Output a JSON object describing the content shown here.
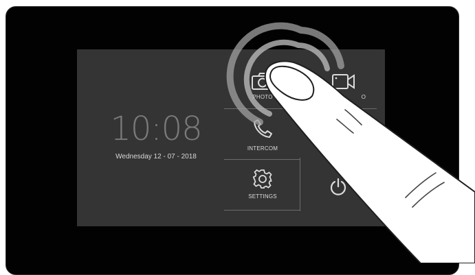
{
  "clock": {
    "time": "10:08",
    "date": "Wednesday 12 - 07 - 2018"
  },
  "menu": {
    "photo": {
      "label": "PHOTO",
      "icon": "camera-icon"
    },
    "video": {
      "label": "VIDEO",
      "visible_label": "O",
      "icon": "video-camera-icon"
    },
    "intercom": {
      "label": "INTERCOM",
      "icon": "phone-icon"
    },
    "settings": {
      "label": "SETTINGS",
      "icon": "gear-icon"
    },
    "power": {
      "icon": "power-icon"
    }
  },
  "colors": {
    "device": "#020202",
    "screen": "#343434",
    "text": "#dcdcdc",
    "clock": "#7a7a7a"
  }
}
